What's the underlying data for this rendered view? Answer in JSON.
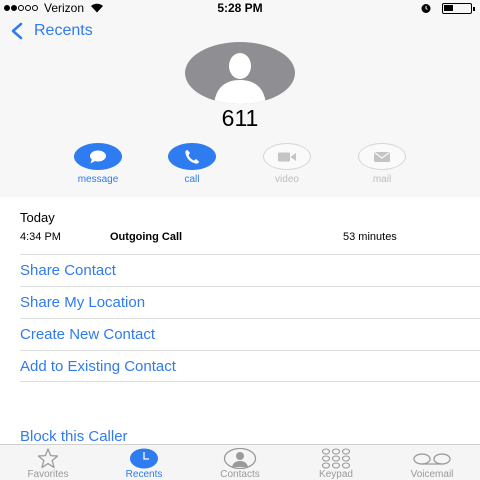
{
  "status": {
    "carrier": "Verizon",
    "time": "5:28 PM"
  },
  "nav": {
    "back_label": "Recents"
  },
  "contact": {
    "name": "611"
  },
  "actions": [
    {
      "label": "message",
      "icon": "message-bubble-icon",
      "enabled": true
    },
    {
      "label": "call",
      "icon": "phone-icon",
      "enabled": true
    },
    {
      "label": "video",
      "icon": "video-camera-icon",
      "enabled": false
    },
    {
      "label": "mail",
      "icon": "envelope-icon",
      "enabled": false
    }
  ],
  "history": {
    "heading": "Today",
    "entries": [
      {
        "time": "4:34 PM",
        "type": "Outgoing Call",
        "duration": "53 minutes"
      }
    ]
  },
  "options": [
    "Share Contact",
    "Share My Location",
    "Create New Contact",
    "Add to Existing Contact"
  ],
  "block_label": "Block this Caller",
  "tabs": [
    {
      "label": "Favorites",
      "icon": "star-icon",
      "active": false
    },
    {
      "label": "Recents",
      "icon": "clock-icon",
      "active": true
    },
    {
      "label": "Contacts",
      "icon": "person-circle-icon",
      "active": false
    },
    {
      "label": "Keypad",
      "icon": "keypad-icon",
      "active": false
    },
    {
      "label": "Voicemail",
      "icon": "voicemail-icon",
      "active": false
    }
  ],
  "colors": {
    "accent": "#2f7bf0",
    "avatar": "#8e8e93",
    "inactive": "#9a9a9a"
  }
}
